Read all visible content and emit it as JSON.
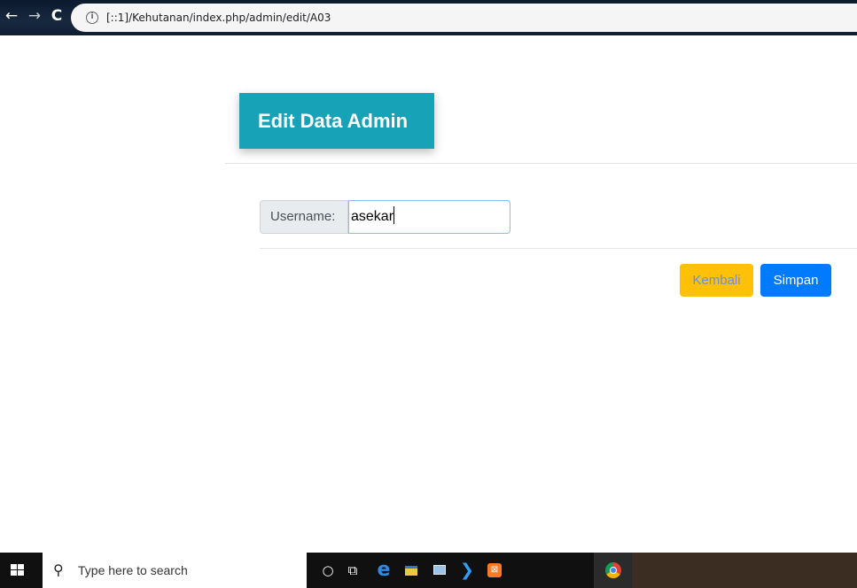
{
  "browser": {
    "url": "[::1]/Kehutanan/index.php/admin/edit/A03",
    "back_glyph": "←",
    "forward_glyph": "→",
    "reload_glyph": "C",
    "info_glyph": "i"
  },
  "card": {
    "title": "Edit Data Admin",
    "accent_color": "#17a2b8"
  },
  "form": {
    "username_label": "Username:",
    "username_value": "asekar"
  },
  "buttons": {
    "back_label": "Kembali",
    "back_color": "#ffc107",
    "save_label": "Simpan",
    "save_color": "#007bff"
  },
  "taskbar": {
    "search_placeholder": "Type here to search",
    "search_glyph": "⚲",
    "cortana_glyph": "○",
    "taskview_glyph": "⧉",
    "edge_glyph": "e",
    "vscode_glyph": "❯",
    "xampp_glyph": "⊠",
    "icons": [
      "windows-icon",
      "search-icon",
      "cortana-icon",
      "task-view-icon",
      "edge-icon",
      "file-explorer-icon",
      "network-icon",
      "vscode-icon",
      "xampp-icon",
      "chrome-icon"
    ]
  }
}
